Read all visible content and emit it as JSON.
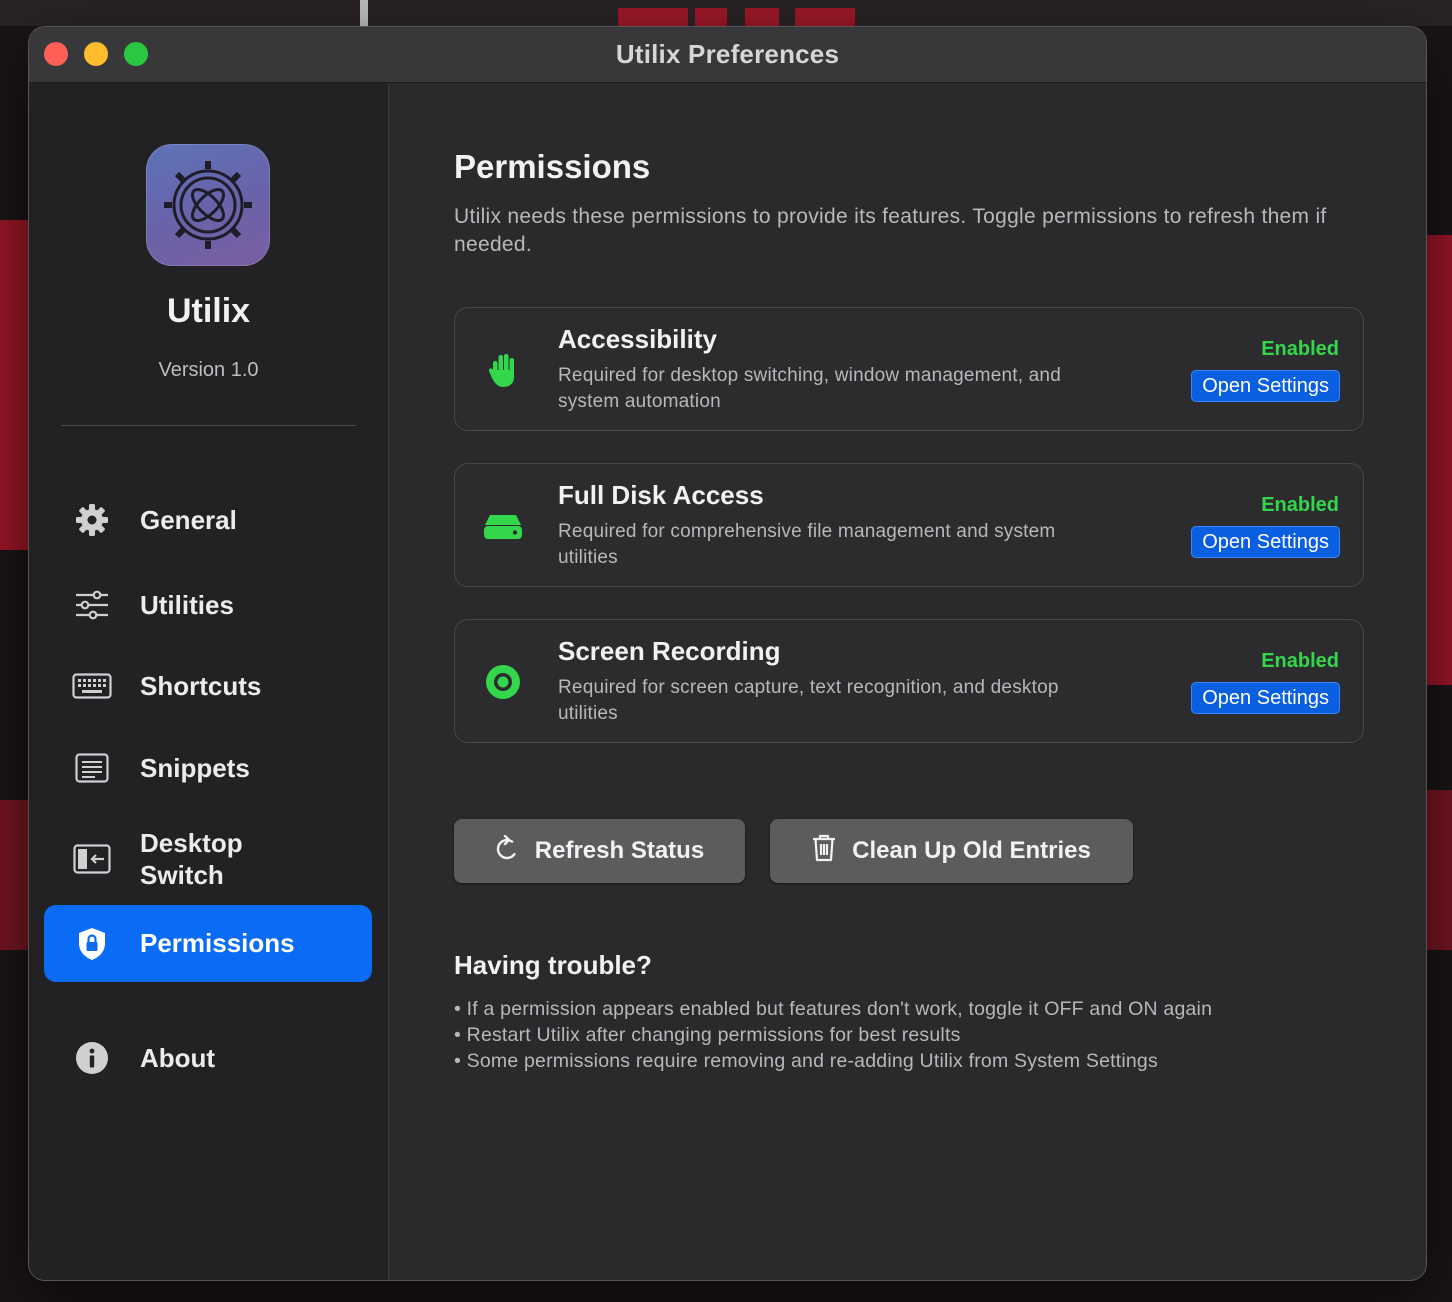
{
  "window": {
    "title": "Utilix Preferences"
  },
  "sidebar": {
    "app_name": "Utilix",
    "version": "Version 1.0",
    "items": [
      {
        "label": "General",
        "icon": "gear-icon"
      },
      {
        "label": "Utilities",
        "icon": "sliders-icon"
      },
      {
        "label": "Shortcuts",
        "icon": "keyboard-icon"
      },
      {
        "label": "Snippets",
        "icon": "document-text-icon"
      },
      {
        "label": "Desktop Switch",
        "icon": "desktop-switch-icon"
      },
      {
        "label": "Permissions",
        "icon": "shield-lock-icon",
        "selected": true
      },
      {
        "label": "About",
        "icon": "info-icon"
      }
    ]
  },
  "main": {
    "title": "Permissions",
    "description": "Utilix needs these permissions to provide its features. Toggle permissions to refresh them if needed.",
    "permissions": [
      {
        "name": "Accessibility",
        "description": "Required for desktop switching, window management, and system automation",
        "status": "Enabled",
        "button": "Open Settings",
        "icon": "hand-icon"
      },
      {
        "name": "Full Disk Access",
        "description": "Required for comprehensive file management and system utilities",
        "status": "Enabled",
        "button": "Open Settings",
        "icon": "disk-icon"
      },
      {
        "name": "Screen Recording",
        "description": "Required for screen capture, text recognition, and desktop utilities",
        "status": "Enabled",
        "button": "Open Settings",
        "icon": "record-icon"
      }
    ],
    "actions": {
      "refresh": "Refresh Status",
      "cleanup": "Clean Up Old Entries"
    },
    "help": {
      "title": "Having trouble?",
      "tips": [
        "If a permission appears enabled but features don't work, toggle it OFF and ON again",
        "Restart Utilix after changing permissions for best results",
        "Some permissions require removing and re-adding Utilix from System Settings"
      ]
    }
  },
  "colors": {
    "accent": "#0a6cf5",
    "enabled": "#32d74b",
    "open_button": "#0a5ee0"
  }
}
